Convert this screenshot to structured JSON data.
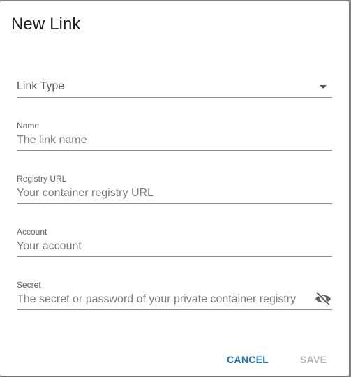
{
  "dialog": {
    "title": "New Link"
  },
  "fields": {
    "link_type": {
      "label": "Link Type"
    },
    "name": {
      "label": "Name",
      "value": "",
      "placeholder": "The link name"
    },
    "registry_url": {
      "label": "Registry URL",
      "value": "",
      "placeholder": "Your container registry URL"
    },
    "account": {
      "label": "Account",
      "value": "",
      "placeholder": "Your account"
    },
    "secret": {
      "label": "Secret",
      "value": "",
      "placeholder": "The secret or password of your private container registry",
      "visibility_icon": "eye-off-icon"
    }
  },
  "actions": {
    "cancel_label": "CANCEL",
    "save_label": "SAVE"
  },
  "colors": {
    "accent": "#1a73c7",
    "disabled": "#b3b3b3",
    "overlay": "#8a8a8a"
  }
}
